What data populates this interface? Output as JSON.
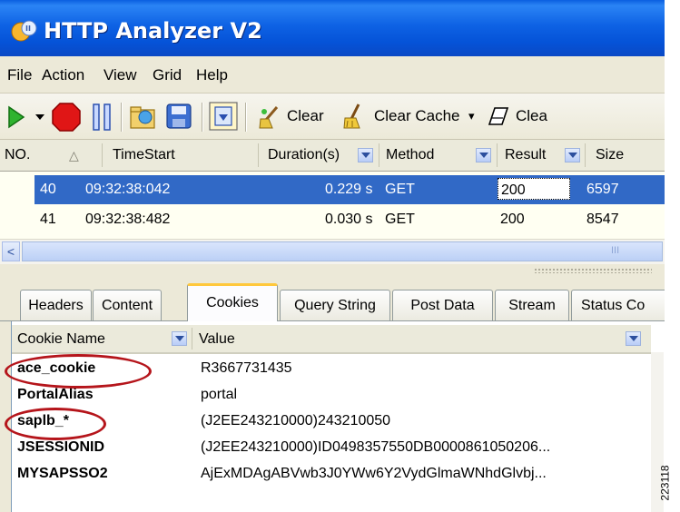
{
  "window": {
    "title": "HTTP Analyzer V2",
    "icon": "http-analyzer-app-icon"
  },
  "menu": [
    "File",
    "Action",
    "View",
    "Grid",
    "Help"
  ],
  "toolbar": {
    "buttons": [
      "play-icon",
      "record-stop-icon",
      "pause-icon",
      "open-folder-icon",
      "save-icon",
      "filter-icon"
    ],
    "clear_label": "Clear",
    "clear_cache_label": "Clear Cache",
    "clear_cache_caret": "▾",
    "clear_other_label": "Clea"
  },
  "grid": {
    "columns": [
      "NO.",
      "TimeStart",
      "Duration(s)",
      "Method",
      "Result",
      "Size"
    ],
    "sort_indicator": "△",
    "rows": [
      {
        "no": "40",
        "time": "09:32:38:042",
        "duration": "0.229 s",
        "method": "GET",
        "result": "200",
        "size": "6597",
        "selected": true
      },
      {
        "no": "41",
        "time": "09:32:38:482",
        "duration": "0.030 s",
        "method": "GET",
        "result": "200",
        "size": "8547",
        "selected": false
      }
    ],
    "scroll_left": "<",
    "thumb_grip": "III"
  },
  "tabs": [
    "Headers",
    "Content",
    "Cookies",
    "Query String",
    "Post Data",
    "Stream",
    "Status Co"
  ],
  "active_tab": "Cookies",
  "cookies": {
    "col_name": "Cookie Name",
    "col_value": "Value",
    "rows": [
      {
        "name": "ace_cookie",
        "value": "R3667731435",
        "circled": true
      },
      {
        "name": "PortalAlias",
        "value": "portal",
        "circled": false
      },
      {
        "name": "saplb_*",
        "value": "(J2EE243210000)243210050",
        "circled": true
      },
      {
        "name": "JSESSIONID",
        "value": "(J2EE243210000)ID0498357550DB0000861050206...",
        "circled": false
      },
      {
        "name": "MYSAPSSO2",
        "value": "AjExMDAgABVwb3J0YWw6Y2VydGlmaWNhdGlvbj...",
        "circled": false
      }
    ]
  },
  "figure_id": "223118",
  "colors": {
    "titlebar": "#0553d8",
    "selection": "#3169c6",
    "callout": "#b5151b",
    "tab_highlight": "#ffc83c"
  }
}
